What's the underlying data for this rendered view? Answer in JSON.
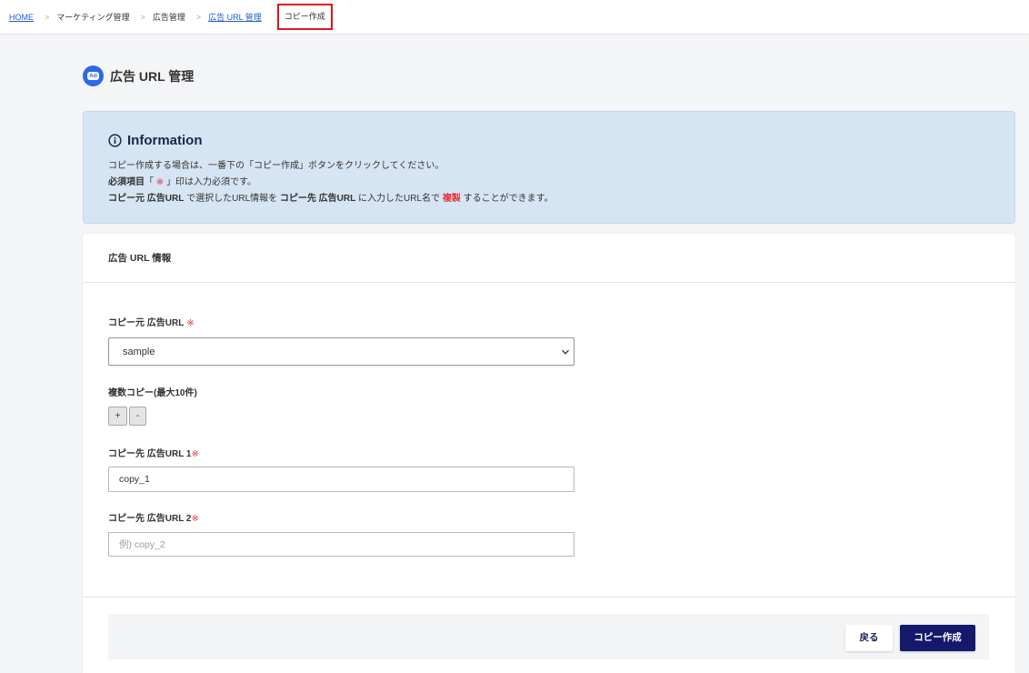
{
  "breadcrumb": {
    "separator": ">",
    "items": [
      {
        "label": "HOME"
      },
      {
        "label": "マーケティング管理"
      },
      {
        "label": "広告管理"
      },
      {
        "label": "広告 URL 管理"
      },
      {
        "label": "コピー作成"
      }
    ]
  },
  "page": {
    "title": "広告 URL 管理",
    "icon": "ad-icon",
    "icon_text": "Ad"
  },
  "info": {
    "title": "Information",
    "icon": "info-circle-icon",
    "line1": "コピー作成する場合は、一番下の「コピー作成」ボタンをクリックしてください。",
    "line2": {
      "bold": "必須項目",
      "before_mark": "「 ",
      "mark": "※",
      "after_mark": " 」印は入力必須です。"
    },
    "line3": {
      "source": "コピー元 広告URL",
      "text1": " で選択したURL情報を ",
      "target": "コピー先 広告URL",
      "text2": " に入力したURL名で ",
      "emphasis": "複製",
      "text3": " することができます。"
    }
  },
  "card": {
    "header": "広告 URL 情報"
  },
  "form": {
    "required_mark": "※",
    "source": {
      "label": "コピー元 広告URL",
      "selected": "sample",
      "icon": "chevron-down-icon"
    },
    "multi_copy": {
      "label": "複数コピー(最大10件)",
      "add": "+",
      "remove": "-"
    },
    "copies": [
      {
        "label": "コピー先 広告URL 1",
        "value": "copy_1"
      },
      {
        "label": "コピー先 広告URL 2",
        "placeholder": "例) copy_2"
      }
    ]
  },
  "actions": {
    "back": "戻る",
    "submit": "コピー作成"
  },
  "colors": {
    "link": "#1a5fd1",
    "required": "#e2363f",
    "info_background": "#d6e5f3",
    "primary_button": "#14196b",
    "highlight_border": "#e0141b",
    "ad_icon": "#2e69e6"
  }
}
